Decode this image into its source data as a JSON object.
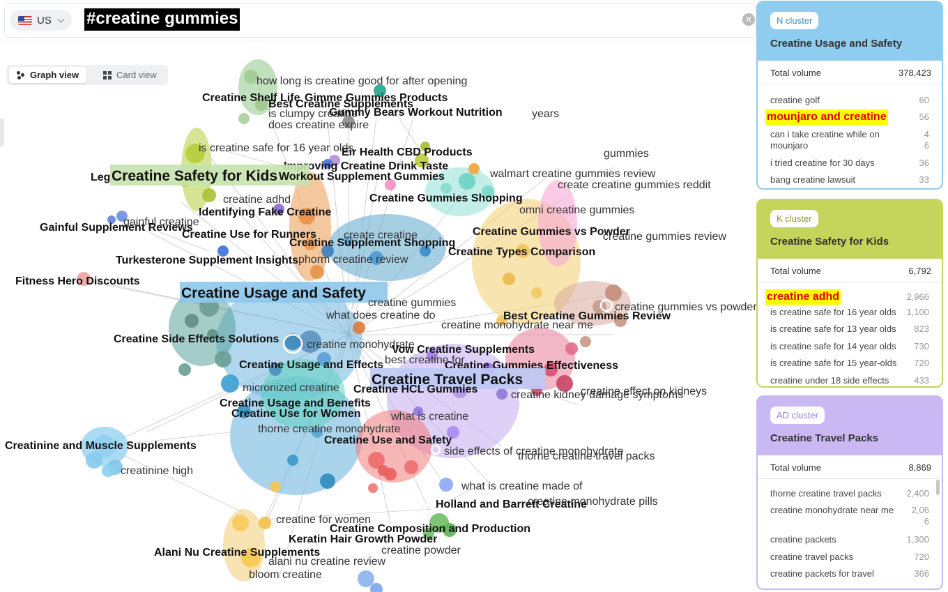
{
  "search": {
    "country": "US",
    "query": "#creatine gummies"
  },
  "view_toggle": {
    "graph_label": "Graph view",
    "card_label": "Card view",
    "active": "graph"
  },
  "graph": {
    "bubbles": [
      {
        "color": "#6fb7de",
        "opacity": 0.6
      },
      {
        "color": "#c0a2ef",
        "opacity": 0.5
      },
      {
        "color": "#7cbde2",
        "opacity": 0.6
      },
      {
        "color": "#5fa7cd",
        "opacity": 0.55
      },
      {
        "color": "#5aa39a",
        "opacity": 0.55
      },
      {
        "color": "#f3d27a",
        "opacity": 0.6
      },
      {
        "color": "#f6a7d6",
        "opacity": 0.6
      },
      {
        "color": "#f07b7b",
        "opacity": 0.55
      },
      {
        "color": "#e77d9a",
        "opacity": 0.55
      },
      {
        "color": "#d9a99a",
        "opacity": 0.55
      },
      {
        "color": "#eda15f",
        "opacity": 0.6
      },
      {
        "color": "#c8dc70",
        "opacity": 0.75
      },
      {
        "color": "#a6d3a2",
        "opacity": 0.7
      },
      {
        "color": "#f6dca0",
        "opacity": 0.8
      },
      {
        "color": "#8ee0d4",
        "opacity": 0.55
      },
      {
        "color": "#8fd0ef",
        "opacity": 0.75
      },
      {
        "color": "#5fd1bd",
        "opacity": 0.55
      }
    ],
    "labels": [
      {
        "text": "how long is creatine good for after opening",
        "bold": false
      },
      {
        "text": "Creatine Shelf Life",
        "bold": true
      },
      {
        "text": "Gimme Gummies Products",
        "bold": true
      },
      {
        "text": "Best Creatine Supplements",
        "bold": true
      },
      {
        "text": "is clumpy creatine",
        "bold": false
      },
      {
        "text": "Gummy Bears Workout Nutrition",
        "bold": true
      },
      {
        "text": "years",
        "bold": false
      },
      {
        "text": "does creatine expire",
        "bold": false
      },
      {
        "text": "is creatine safe for 16 year olds",
        "bold": false
      },
      {
        "text": "Eir Health CBD Products",
        "bold": true
      },
      {
        "text": "gummies",
        "bold": false
      },
      {
        "text": "Improving Creatine Drink Taste",
        "bold": true
      },
      {
        "text": "Leg",
        "bold": true
      },
      {
        "text": "Creatine Safety for Kids",
        "bold": true,
        "big": true,
        "bg": "#c5e2ae"
      },
      {
        "text": "Workout Supplement Gummies",
        "bold": true
      },
      {
        "text": "walmart creatine gummies review",
        "bold": false
      },
      {
        "text": "create creatine gummies reddit",
        "bold": false
      },
      {
        "text": "creatine adhd",
        "bold": false
      },
      {
        "text": "Creatine Gummies Shopping",
        "bold": true
      },
      {
        "text": "omni creatine gummies",
        "bold": false
      },
      {
        "text": "Identifying Fake Creatine",
        "bold": true
      },
      {
        "text": "gainful creatine",
        "bold": false
      },
      {
        "text": "Gainful Supplement Reviews",
        "bold": true
      },
      {
        "text": "Creatine Use for Runners",
        "bold": true
      },
      {
        "text": "create creatine",
        "bold": false
      },
      {
        "text": "Creatine Gummies vs Powder",
        "bold": true
      },
      {
        "text": "creatine gummies review",
        "bold": false
      },
      {
        "text": "Creatine Supplement Shopping",
        "bold": true
      },
      {
        "text": "Creatine Types Comparison",
        "bold": true
      },
      {
        "text": "Turkesterone Supplement Insights",
        "bold": true
      },
      {
        "text": "phorm creatine review",
        "bold": false
      },
      {
        "text": "Fitness Hero Discounts",
        "bold": true
      },
      {
        "text": "Creatine Usage and Safety",
        "bold": true,
        "big": true,
        "bg": "#8ec8ec"
      },
      {
        "text": "creatine gummies",
        "bold": false
      },
      {
        "text": "what does creatine do",
        "bold": false
      },
      {
        "text": "creatine gummies vs powder",
        "bold": false
      },
      {
        "text": "Best Creatine Gummies Review",
        "bold": true
      },
      {
        "text": "creatine monohydrate near me",
        "bold": false
      },
      {
        "text": "Creatine Side Effects Solutions",
        "bold": true
      },
      {
        "text": "creatine monohydrate",
        "bold": false
      },
      {
        "text": "Vow Creatine Supplements",
        "bold": true
      },
      {
        "text": "best creatine for",
        "bold": false
      },
      {
        "text": "Creatine Usage and Effects",
        "bold": true
      },
      {
        "text": "Creatine Gummies Effectiveness",
        "bold": true
      },
      {
        "text": "micronized creatine",
        "bold": false
      },
      {
        "text": "Creatine Travel Packs",
        "bold": true,
        "big": true,
        "bg": "#bccaf4"
      },
      {
        "text": "Creatine HCL Gummies",
        "bold": true
      },
      {
        "text": "creatine effect on kidneys",
        "bold": false
      },
      {
        "text": "creatine kidney damage symptoms",
        "bold": false
      },
      {
        "text": "Creatine Usage and Benefits",
        "bold": true
      },
      {
        "text": "Creatine Use for Women",
        "bold": true
      },
      {
        "text": "what is creatine",
        "bold": false
      },
      {
        "text": "thorne creatine monohydrate",
        "bold": false
      },
      {
        "text": "Creatine Use and Safety",
        "bold": true
      },
      {
        "text": "Creatinine and Muscle Supplements",
        "bold": true
      },
      {
        "text": "side effects of creatine monohydrate",
        "bold": false
      },
      {
        "text": "thorne creatine travel packs",
        "bold": false
      },
      {
        "text": "creatinine high",
        "bold": false
      },
      {
        "text": "what is creatine made of",
        "bold": false
      },
      {
        "text": "Holland and Barrett Creatine",
        "bold": true
      },
      {
        "text": "creatine monohydrate pills",
        "bold": false
      },
      {
        "text": "creatine for women",
        "bold": false
      },
      {
        "text": "Creatine Composition and Production",
        "bold": true
      },
      {
        "text": "Keratin Hair Growth Powder",
        "bold": true
      },
      {
        "text": "creatine powder",
        "bold": false
      },
      {
        "text": "Alani Nu Creatine Supplements",
        "bold": true
      },
      {
        "text": "alani nu creatine review",
        "bold": false
      },
      {
        "text": "bloom creatine",
        "bold": false
      }
    ]
  },
  "clusters": [
    {
      "badge": "N cluster",
      "title": "Creatine Usage and Safety",
      "header_color": "#8fcdf0",
      "border_color": "#8fcdf0",
      "total_label": "Total volume",
      "total_value": "378,423",
      "keywords": [
        {
          "text": "creatine golf",
          "value": "60"
        },
        {
          "text": "mounjaro and creatine",
          "value": "56",
          "highlight": true
        },
        {
          "text": "can i take creatine while on mounjaro",
          "value": "46"
        },
        {
          "text": "i tried creatine for 30 days",
          "value": "36"
        },
        {
          "text": "bang creatine lawsuit",
          "value": "33"
        }
      ]
    },
    {
      "badge": "K cluster",
      "title": "Creatine Safety for Kids",
      "header_color": "#c5d45a",
      "border_color": "#c5d45a",
      "total_label": "Total volume",
      "total_value": "6,792",
      "keywords": [
        {
          "text": "creatine adhd",
          "value": "2,966",
          "highlight": true
        },
        {
          "text": "is creatine safe for 16 year olds",
          "value": "1,100"
        },
        {
          "text": "is creatine safe for 13 year olds",
          "value": "823"
        },
        {
          "text": "is creatine safe for 14 year olds",
          "value": "730"
        },
        {
          "text": "is creatine safe for 15 year-olds",
          "value": "720"
        },
        {
          "text": "creatine under 18 side effects",
          "value": "433"
        }
      ]
    },
    {
      "badge": "AD cluster",
      "title": "Creatine Travel Packs",
      "header_color": "#c9b8f3",
      "border_color": "#c9b8f3",
      "total_label": "Total volume",
      "total_value": "8,869",
      "keywords": [
        {
          "text": "thorne creatine travel packs",
          "value": "2,400"
        },
        {
          "text": "creatine monohydrate near me",
          "value": "2,066"
        },
        {
          "text": "creatine packets",
          "value": "1,300"
        },
        {
          "text": "creatine travel packs",
          "value": "720"
        },
        {
          "text": "creatine packets for travel",
          "value": "366"
        }
      ]
    }
  ]
}
